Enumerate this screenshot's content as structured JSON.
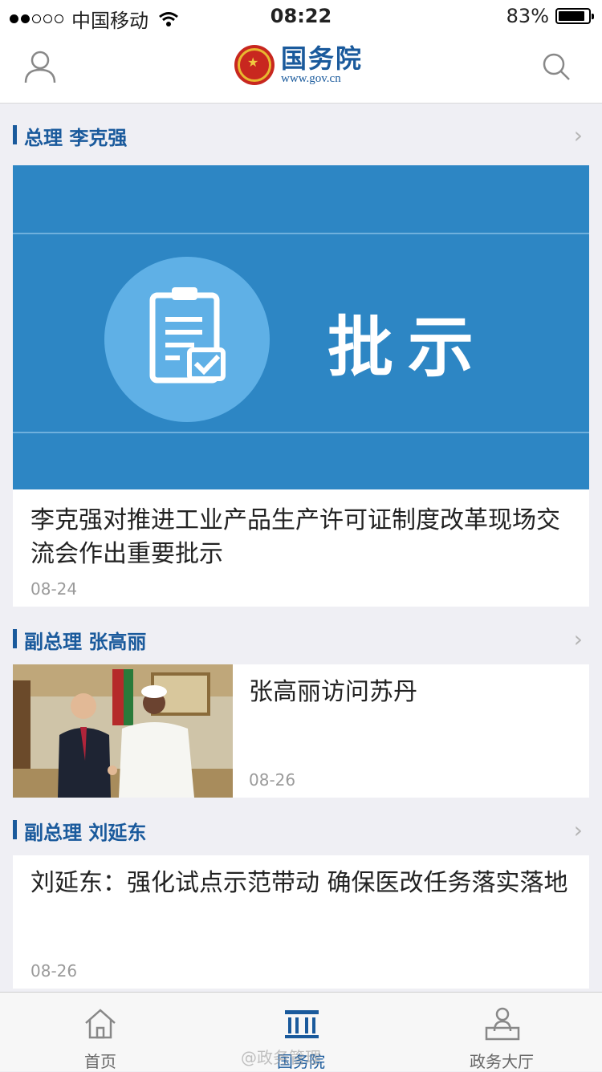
{
  "status_bar": {
    "carrier": "中国移动",
    "time": "08:22",
    "battery": "83%"
  },
  "header": {
    "logo_cn": "国务院",
    "logo_url": "www.gov.cn"
  },
  "sections": [
    {
      "title": "总理 李克强",
      "image_text": "批示",
      "article_title": "李克强对推进工业产品生产许可证制度改革现场交流会作出重要批示",
      "date": "08-24"
    },
    {
      "title": "副总理 张高丽",
      "article_title": "张高丽访问苏丹",
      "date": "08-26"
    },
    {
      "title": "副总理 刘延东",
      "article_title": "刘延东：强化试点示范带动 确保医改任务落实落地",
      "date": "08-26"
    }
  ],
  "tabbar": {
    "items": [
      {
        "label": "首页"
      },
      {
        "label": "国务院"
      },
      {
        "label": "政务大厅"
      }
    ],
    "active_index": 1
  },
  "watermark": "@政务管理",
  "colors": {
    "brand_blue": "#1a5a9c",
    "hero_blue": "#2d86c4",
    "page_bg": "#efeff4"
  }
}
